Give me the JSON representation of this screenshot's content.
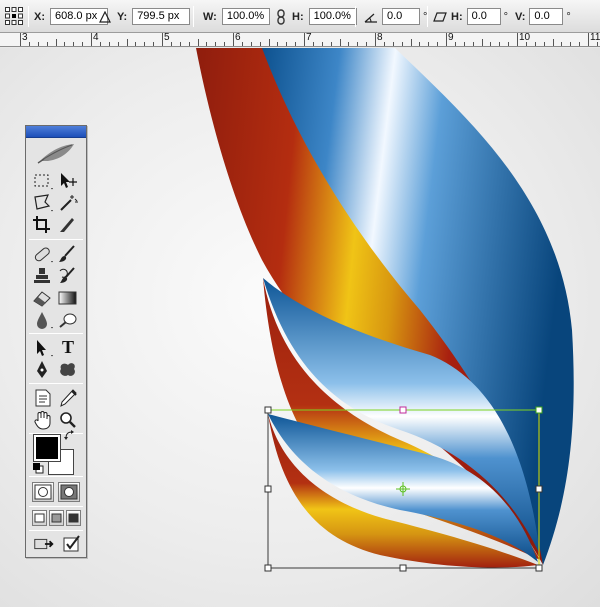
{
  "options_bar": {
    "x_label": "X:",
    "x_value": "608.0 px",
    "y_label": "Y:",
    "y_value": "799.5 px",
    "w_label": "W:",
    "w_value": "100.0%",
    "h_label": "H:",
    "h_value": "100.0%",
    "rotate_value": "0.0",
    "degree_symbol": "°",
    "hskew_label": "H:",
    "hskew_value": "0.0",
    "vskew_label": "V:",
    "vskew_value": "0.0"
  },
  "ruler": {
    "labels": [
      "3",
      "4",
      "5",
      "6",
      "7",
      "8",
      "9",
      "10",
      "11"
    ]
  },
  "tools": {
    "type_tool_glyph": "T"
  },
  "colors": {
    "foreground": "#000000",
    "background": "#ffffff",
    "accent_blue": "#0a5290",
    "accent_red": "#a8230f",
    "accent_gold": "#e8c015"
  }
}
